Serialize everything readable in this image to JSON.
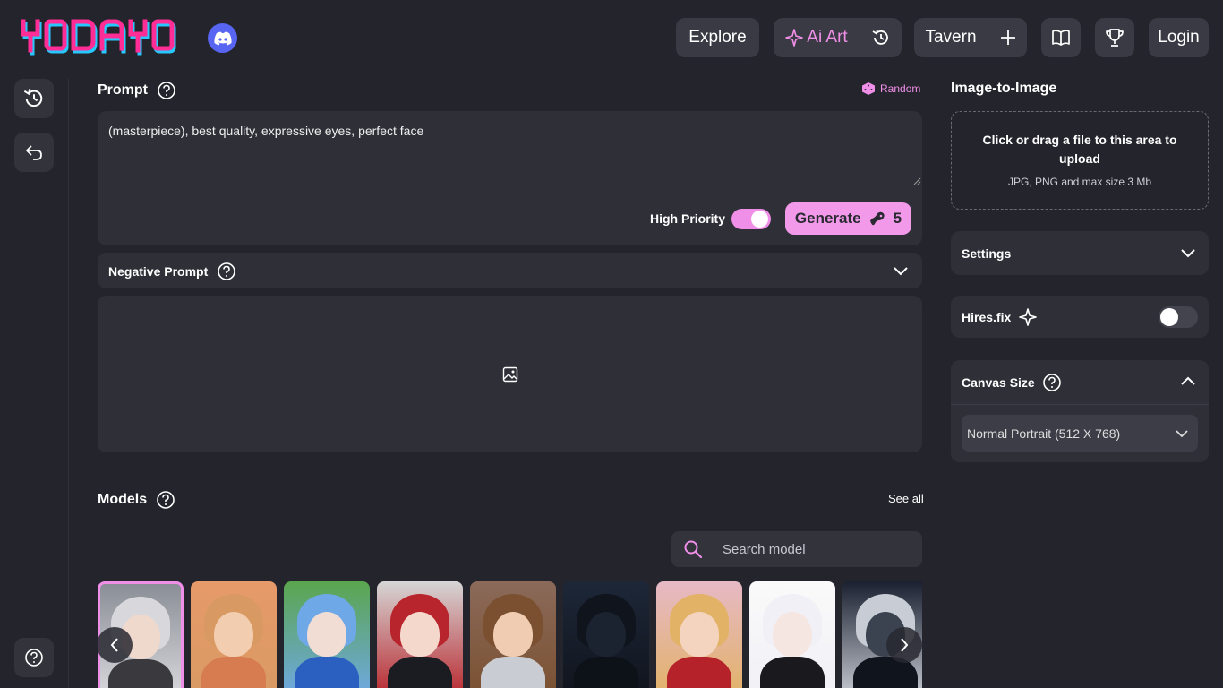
{
  "brand": {
    "logo_text": "YODAYO",
    "accent": "#f08fe8",
    "logo_pink": "#ff2d95",
    "logo_cyan": "#27c7ff",
    "discord": "#5865f2"
  },
  "header": {
    "explore": "Explore",
    "ai_art": "Ai Art",
    "tavern": "Tavern",
    "login": "Login",
    "icons": [
      "discord-icon",
      "sparkle-icon",
      "history-icon",
      "plus-icon",
      "book-icon",
      "trophy-icon"
    ]
  },
  "sidebar": {
    "icons": [
      "history-icon",
      "undo-icon",
      "help-icon"
    ]
  },
  "prompt": {
    "title": "Prompt",
    "random": "Random",
    "value": "(masterpiece), best quality, expressive eyes, perfect face",
    "high_priority": "High Priority",
    "high_priority_on": true,
    "generate": "Generate",
    "cost": "5"
  },
  "negative_prompt": {
    "title": "Negative Prompt"
  },
  "models": {
    "title": "Models",
    "see_all": "See all",
    "search_placeholder": "Search model",
    "cards": [
      {
        "hair": "#d8d8dc",
        "face": "#efd8cc",
        "body": "#3a3a3e",
        "bg": "#8a8e96"
      },
      {
        "hair": "#d89a62",
        "face": "#f3cdb0",
        "body": "#d77b50",
        "bg": "#e79a6a"
      },
      {
        "hair": "#6fa8e6",
        "face": "#f2ddd4",
        "body": "#2b5fc0",
        "bg": "#5aa64e"
      },
      {
        "hair": "#b8252c",
        "face": "#f4d8cc",
        "body": "#1b1b22",
        "bg": "#d6d6d6"
      },
      {
        "hair": "#7a5030",
        "face": "#f0cdb2",
        "body": "#c9ccd2",
        "bg": "#8b6a5a"
      },
      {
        "hair": "#10141c",
        "face": "#1b2230",
        "body": "#0d1118",
        "bg": "#1d2738"
      },
      {
        "hair": "#e2b266",
        "face": "#f4d4be",
        "body": "#b5222a",
        "bg": "#e7b9c6"
      },
      {
        "hair": "#f0f0f6",
        "face": "#f6e6e2",
        "body": "#1a1a1e",
        "bg": "#fafafa"
      },
      {
        "hair": "#c8ccd4",
        "face": "#3b4250",
        "body": "#10141c",
        "bg": "#1a2030"
      }
    ]
  },
  "image_to_image": {
    "title": "Image-to-Image",
    "upload_text": "Click or drag a file to this area to upload",
    "upload_hint": "JPG, PNG and max size 3 Mb"
  },
  "settings": {
    "title": "Settings"
  },
  "hires": {
    "title": "Hires.fix",
    "enabled": false
  },
  "canvas": {
    "title": "Canvas Size",
    "selected": "Normal Portrait (512 X 768)"
  }
}
